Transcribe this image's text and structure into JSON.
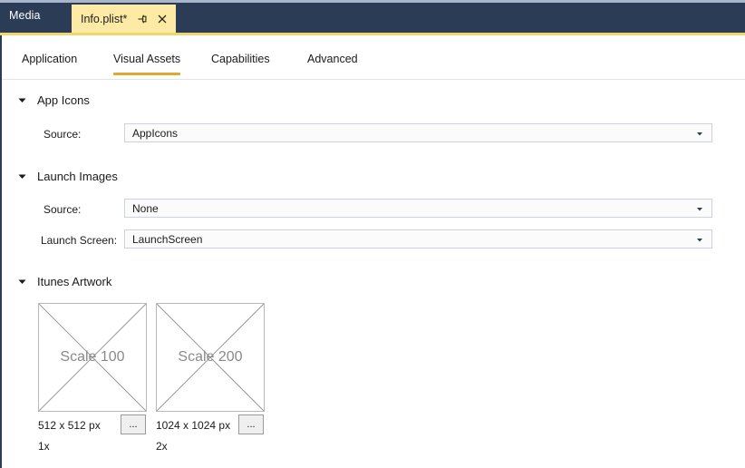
{
  "titlebar": {
    "media_label": "Media",
    "document_tab": {
      "title": "Info.plist*",
      "pin_icon": "pin-icon",
      "close_icon": "close-icon"
    }
  },
  "designer_tabs": [
    {
      "label": "Application",
      "selected": false
    },
    {
      "label": "Visual Assets",
      "selected": true
    },
    {
      "label": "Capabilities",
      "selected": false
    },
    {
      "label": "Advanced",
      "selected": false
    }
  ],
  "sections": {
    "app_icons": {
      "title": "App Icons",
      "chevron_icon": "chevron-down-icon",
      "source_label": "Source:",
      "source_value": "AppIcons",
      "dropdown_icon": "chevron-down-icon"
    },
    "launch_images": {
      "title": "Launch Images",
      "chevron_icon": "chevron-down-icon",
      "source_label": "Source:",
      "source_value": "None",
      "launch_screen_label": "Launch Screen:",
      "launch_screen_value": "LaunchScreen",
      "dropdown_icon": "chevron-down-icon"
    },
    "itunes_artwork": {
      "title": "Itunes Artwork",
      "chevron_icon": "chevron-down-icon",
      "items": [
        {
          "caption": "Scale 100",
          "size": "512 x 512 px",
          "browse_label": "...",
          "scale": "1x"
        },
        {
          "caption": "Scale 200",
          "size": "1024 x 1024 px",
          "browse_label": "...",
          "scale": "2x"
        }
      ]
    }
  },
  "colors": {
    "titlebar_bg": "#2b3c57",
    "active_tab_bg": "#fdeaa5",
    "gold_underline": "#f3d66b",
    "tab_accent": "#e0a82e",
    "combobox_border": "#ccd2de"
  }
}
